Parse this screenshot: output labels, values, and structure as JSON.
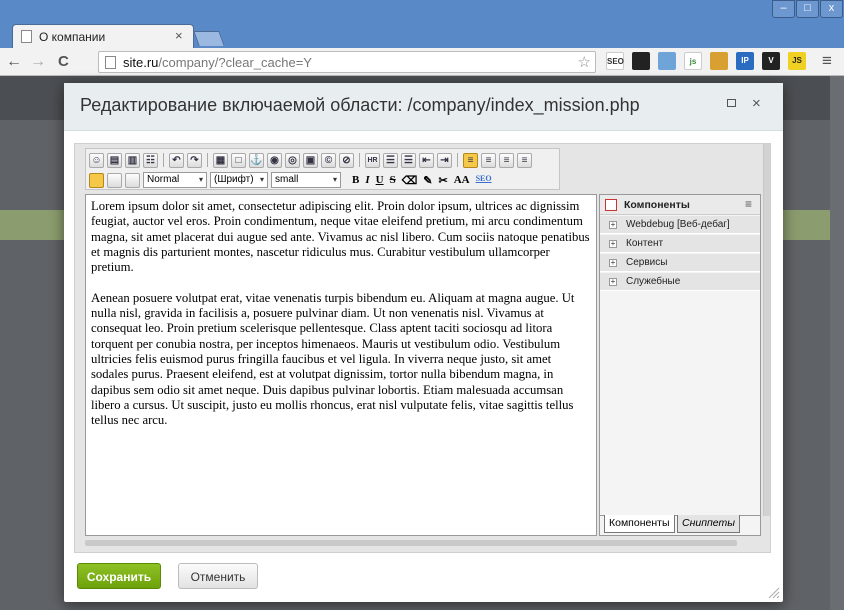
{
  "browser": {
    "tab_title": "О компании",
    "tab_close": "×",
    "url_host": "site.ru",
    "url_path": "/company/?clear_cache=Y",
    "back": "←",
    "forward": "→",
    "reload": "C",
    "star": "☆",
    "menu": "≡",
    "window_min": "–",
    "window_max": "□",
    "window_close": "x",
    "extensions": [
      {
        "label": "SEO",
        "color": "#ffffff",
        "text_color": "#333333",
        "icon": "seo-icon"
      },
      {
        "label": "",
        "color": "#222222",
        "text_color": "#ffffff",
        "icon": "colorpicker-icon"
      },
      {
        "label": "",
        "color": "#6fa4d8",
        "text_color": "#ffffff",
        "icon": "window-icon"
      },
      {
        "label": "js",
        "color": "#ffffff",
        "text_color": "#3a8a3a",
        "icon": "js-debug-icon"
      },
      {
        "label": "",
        "color": "#d8a030",
        "text_color": "#ffffff",
        "icon": "cookie-icon"
      },
      {
        "label": "IP",
        "color": "#2a6cc0",
        "text_color": "#ffffff",
        "icon": "ip-icon"
      },
      {
        "label": "V",
        "color": "#222222",
        "text_color": "#ffffff",
        "icon": "v-icon"
      },
      {
        "label": "JS",
        "color": "#f0d020",
        "text_color": "#222222",
        "icon": "js-icon"
      }
    ]
  },
  "dialog": {
    "title": "Редактирование включаемой области: /company/index_mission.php",
    "max_label": "",
    "close_label": "×"
  },
  "toolbar": {
    "row1": [
      "☺",
      "▤",
      "▥",
      "☷",
      "↶",
      "↷",
      "▦",
      "□",
      "⚓",
      "◉",
      "◎",
      "▣",
      "©",
      "⊘",
      "HR",
      "☰",
      "☰",
      "⇤",
      "⇥",
      "≡",
      "≡",
      "≡",
      "≡"
    ],
    "row1_active_index": 19,
    "style_select": "Normal",
    "font_select": "(Шрифт)",
    "size_select": "small",
    "format_buttons": [
      "B",
      "I",
      "U",
      "S",
      "⌫",
      "✎",
      "✂",
      "AA",
      "SEO"
    ],
    "arrow": "▾"
  },
  "content": {
    "paragraphs": [
      "Lorem ipsum dolor sit amet, consectetur adipiscing elit. Proin dolor ipsum, ultrices ac dignissim feugiat, auctor vel eros. Proin condimentum, neque vitae eleifend pretium, mi arcu condimentum magna, sit amet placerat dui augue sed ante. Vivamus ac nisl libero. Cum sociis natoque penatibus et magnis dis parturient montes, nascetur ridiculus mus. Curabitur vestibulum ullamcorper pretium.",
      "Aenean posuere volutpat erat, vitae venenatis turpis bibendum eu. Aliquam at magna augue. Ut nulla nisl, gravida in facilisis a, posuere pulvinar diam. Ut non venenatis nisl. Vivamus at consequat leo. Proin pretium scelerisque pellentesque. Class aptent taciti sociosqu ad litora torquent per conubia nostra, per inceptos himenaeos. Mauris ut vestibulum odio. Vestibulum ultricies felis euismod purus fringilla faucibus et vel ligula. In viverra neque justo, sit amet sodales purus. Praesent eleifend, est at volutpat dignissim, tortor nulla bibendum magna, in dapibus sem odio sit amet neque. Duis dapibus pulvinar lobortis. Etiam malesuada accumsan libero a cursus. Ut suscipit, justo eu mollis rhoncus, erat nisl vulputate felis, vitae sagittis tellus tellus nec arcu."
    ]
  },
  "components": {
    "header": "Компоненты",
    "menu": "≡",
    "items": [
      "Webdebug [Веб-дебаг]",
      "Контент",
      "Сервисы",
      "Служебные"
    ],
    "plus": "+",
    "tabs": {
      "components": "Компоненты",
      "snippets": "Сниппеты"
    }
  },
  "buttons": {
    "save": "Сохранить",
    "cancel": "Отменить"
  },
  "colors": {
    "accent_green": "#7ab317",
    "titlebar": "#5a89c8",
    "overlay": "#5f6266"
  }
}
